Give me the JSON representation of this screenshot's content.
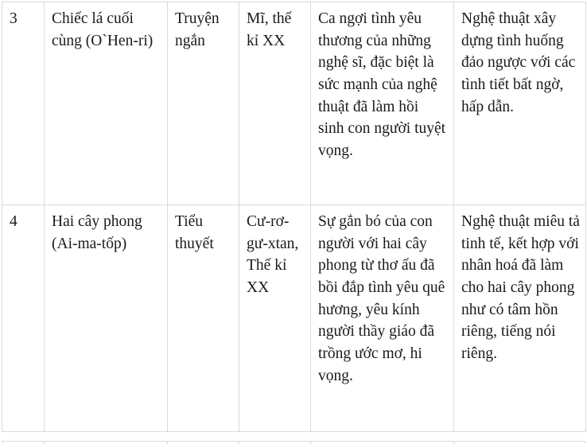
{
  "document": {
    "type": "table",
    "background_color": "#ffffff",
    "border_color": "#d9d9d9",
    "text_color": "#1a1a1a"
  },
  "table": {
    "columns": [
      {
        "key": "no",
        "header": ""
      },
      {
        "key": "title",
        "header": ""
      },
      {
        "key": "genre",
        "header": ""
      },
      {
        "key": "origin",
        "header": ""
      },
      {
        "key": "content",
        "header": ""
      },
      {
        "key": "art",
        "header": ""
      }
    ],
    "rows": [
      {
        "no": "3",
        "title": "Chiếc lá cuối cùng (O`Hen-ri)",
        "genre": "Truyện ngắn",
        "origin": "Mĩ, thế kỉ XX",
        "content": "Ca ngợi tình yêu thương của những nghệ sĩ, đặc biệt là sức mạnh của nghệ thuật đã làm hồi sinh con người tuyệt vọng.",
        "art": "Nghệ thuật xây dựng tình huống đảo ngược với các tình tiết bất ngờ, hấp dẫn."
      },
      {
        "no": "4",
        "title": "Hai cây phong (Ai-ma-tốp)",
        "genre": "Tiểu thuyết",
        "origin": "Cư-rơ-gư-xtan, Thế kỉ XX",
        "content": "Sự gắn bó của con người với hai cây phong từ thơ ấu đã bồi đắp tình yêu quê hương, yêu kính người thầy giáo đã trồng ước mơ, hi vọng.",
        "art": "Nghệ thuật miêu tả tinh tế, kết hợp với nhân hoá đã làm cho hai cây phong như có tâm hồn riêng, tiếng nói riêng."
      }
    ]
  }
}
